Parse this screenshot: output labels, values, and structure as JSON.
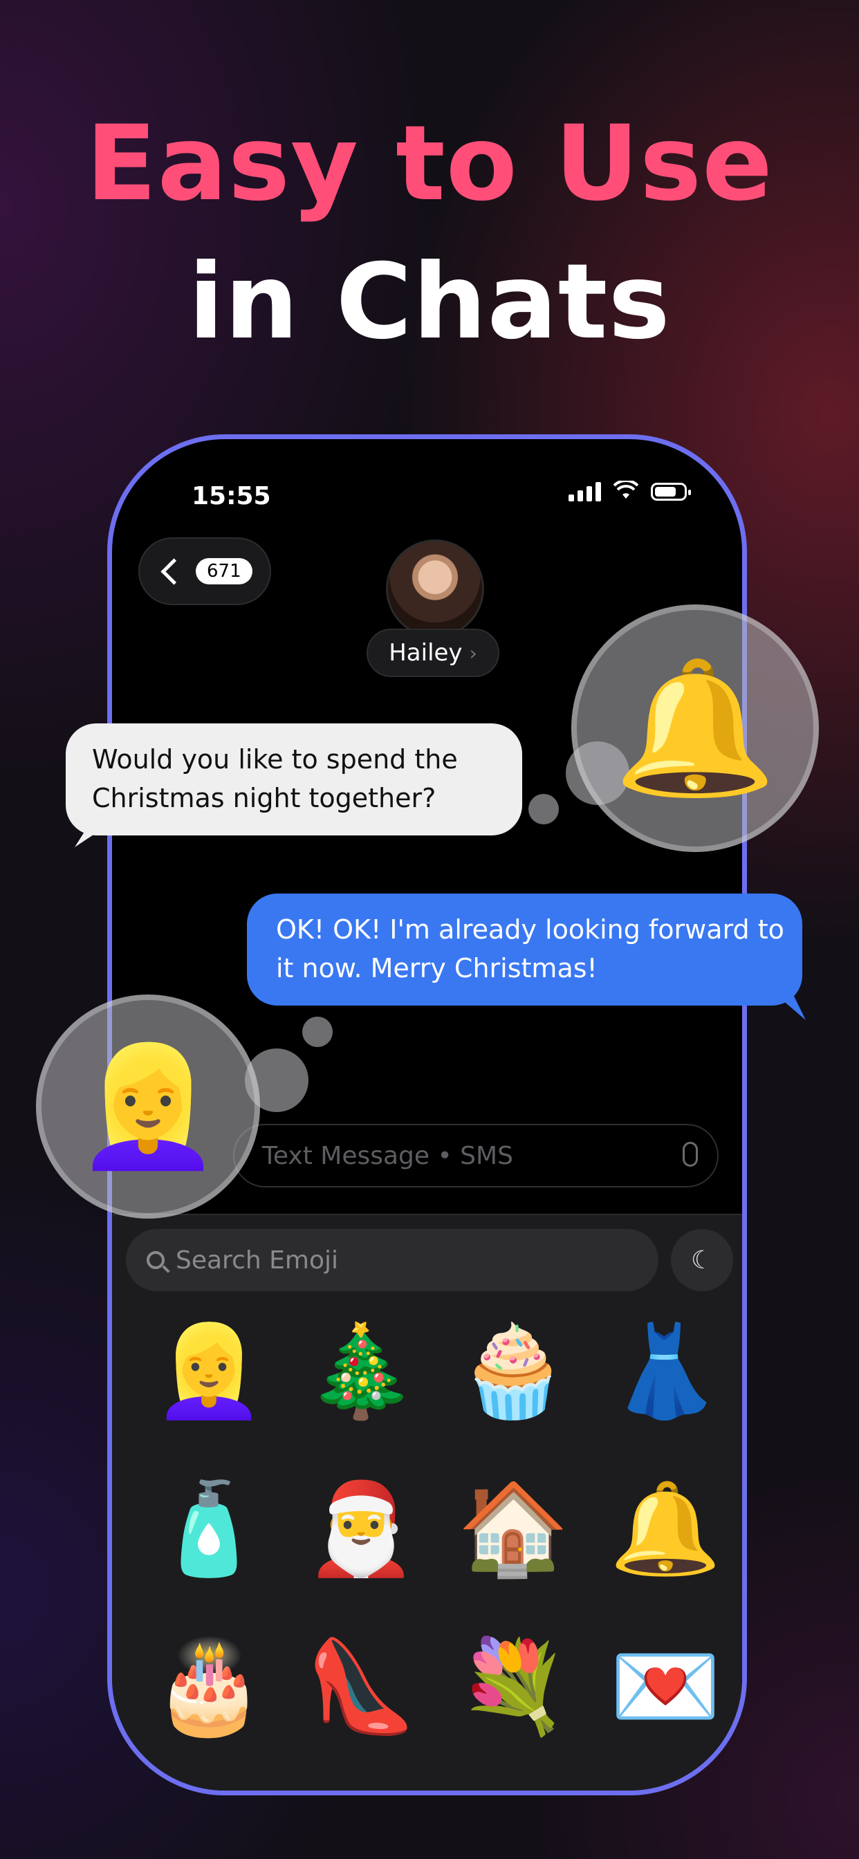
{
  "headline": {
    "line1": "Easy to Use",
    "line2": "in Chats"
  },
  "status_bar": {
    "time": "15:55"
  },
  "chat_header": {
    "back_count": "671",
    "contact_name": "Hailey"
  },
  "messages": [
    {
      "side": "incoming",
      "text": "Would you like to spend the Christmas night together?"
    },
    {
      "side": "outgoing",
      "text": "OK! OK! I'm already looking forward to it now. Merry Christmas!"
    }
  ],
  "thought_stickers": {
    "right": "🔔",
    "left": "👱‍♀️"
  },
  "input": {
    "placeholder": "Text Message • SMS"
  },
  "emoji_panel": {
    "search_placeholder": "Search Emoji",
    "stickers": [
      "👱‍♀️",
      "🎄",
      "🧁",
      "👗",
      "🧴",
      "🎅",
      "🏠",
      "🔔",
      "🎂",
      "👠",
      "💐",
      "💌"
    ]
  },
  "colors": {
    "accent_pink": "#ff4f79",
    "phone_frame": "#6d6ff0",
    "outgoing_bubble": "#3a78f2"
  }
}
